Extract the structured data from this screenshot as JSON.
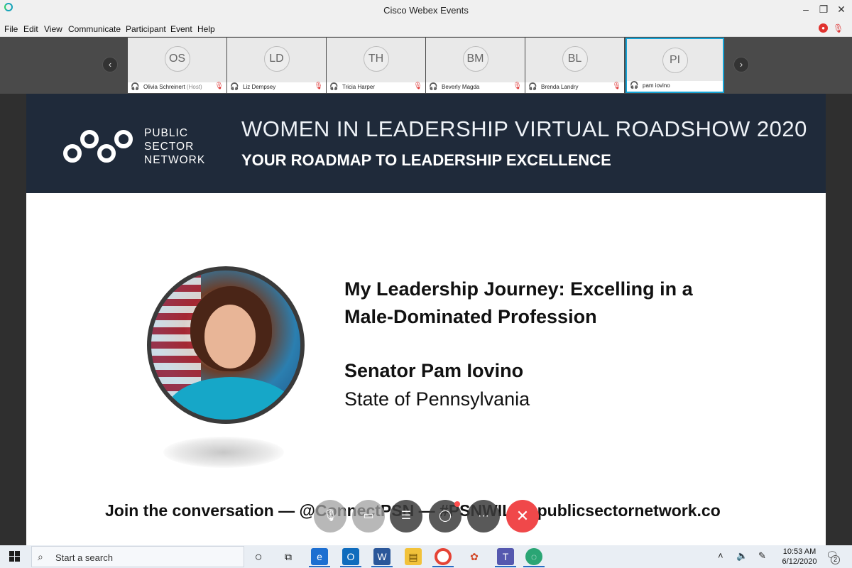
{
  "window": {
    "title": "Cisco Webex Events",
    "min_icon": "–",
    "restore_icon": "❐",
    "close_icon": "✕"
  },
  "menu": [
    "File",
    "Edit",
    "View",
    "Communicate",
    "Participant",
    "Event",
    "Help"
  ],
  "participants": [
    {
      "initials": "OS",
      "name": "Olivia Schreinert",
      "role": "(Host)",
      "active": false
    },
    {
      "initials": "LD",
      "name": "Liz Dempsey",
      "role": "",
      "active": false
    },
    {
      "initials": "TH",
      "name": "Tricia Harper",
      "role": "",
      "active": false
    },
    {
      "initials": "BM",
      "name": "Beverly Magda",
      "role": "",
      "active": false
    },
    {
      "initials": "BL",
      "name": "Brenda Landry",
      "role": "",
      "active": false
    },
    {
      "initials": "PI",
      "name": "pam iovino",
      "role": "",
      "active": true
    }
  ],
  "strip_nav": {
    "prev": "‹",
    "next": "›"
  },
  "slide": {
    "org_name_lines": [
      "PUBLIC",
      "SECTOR",
      "NETWORK"
    ],
    "banner_title": "WOMEN IN LEADERSHIP VIRTUAL ROADSHOW 2020",
    "banner_subtitle": "YOUR ROADMAP TO LEADERSHIP EXCELLENCE",
    "talk_title_line1": "My Leadership Journey: Excelling in a",
    "talk_title_line2": "Male-Dominated Profession",
    "speaker_name": "Senator Pam Iovino",
    "speaker_org": "State of Pennsylvania",
    "join_line": "Join the conversation — @ConnectPSN — #PSNWIL — publicsectornetwork.co"
  },
  "controls": [
    "mute-button",
    "video-button",
    "participants-button",
    "chat-button",
    "more-button",
    "leave-button"
  ],
  "taskbar": {
    "search_placeholder": "Start a search",
    "time": "10:53 AM",
    "date": "6/12/2020",
    "notification_count": "2"
  },
  "colors": {
    "banner_bg": "#1f2a3a",
    "active_tile_border": "#14a3d6",
    "end_call": "#f0484a"
  }
}
